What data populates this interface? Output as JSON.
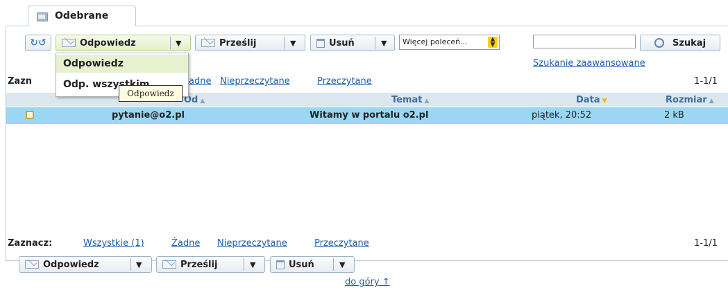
{
  "tab": {
    "label": "Odebrane"
  },
  "toolbar": {
    "reply_label": "Odpowiedz",
    "forward_label": "Prześlij",
    "delete_label": "Usuń",
    "more_commands_value": "Więcej poleceń...",
    "search_button_label": "Szukaj",
    "search_input_value": "",
    "advanced_search_link": "Szukanie zaawansowane"
  },
  "reply_menu": {
    "items": [
      "Odpowiedz",
      "Odp. wszystkim"
    ],
    "tooltip": "Odpowiedz"
  },
  "select_bar_top": {
    "prefix": "Zazn",
    "none_partial": "adne",
    "unread": "Nieprzeczytane",
    "read": "Przeczytane",
    "range": "1-1/1"
  },
  "columns": {
    "from": "Od",
    "subject": "Temat",
    "date": "Data",
    "size": "Rozmiar"
  },
  "messages": [
    {
      "from": "pytanie@o2.pl",
      "subject": "Witamy w portalu o2.pl",
      "date": "piątek, 20:52",
      "size": "2 kB"
    }
  ],
  "select_bar_bottom": {
    "prefix": "Zaznacz:",
    "all": "Wszystkie (1)",
    "none": "Żadne",
    "unread": "Nieprzeczytane",
    "read": "Przeczytane",
    "range": "1-1/1"
  },
  "footer": {
    "top_link": "do góry ↑"
  },
  "colors": {
    "selected_row": "#9bd6f3",
    "header_row": "#dce6ef",
    "link": "#1f5fa8",
    "sort_active": "#f5b800"
  }
}
